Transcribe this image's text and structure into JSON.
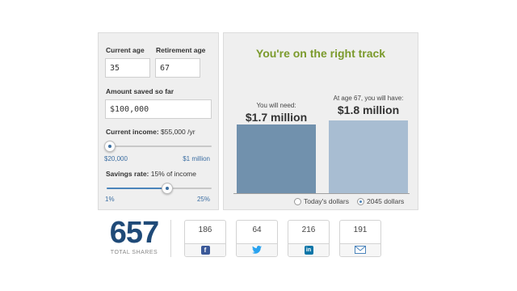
{
  "form": {
    "current_age_label": "Current age",
    "current_age_value": "35",
    "retirement_age_label": "Retirement age",
    "retirement_age_value": "67",
    "amount_saved_label": "Amount saved so far",
    "amount_saved_value": "$100,000",
    "income_label": "Current income:",
    "income_value": "$55,000 /yr",
    "income_min": "$20,000",
    "income_max": "$1 million",
    "income_slider_fraction": 0.03,
    "savings_label": "Savings rate:",
    "savings_value": "15%  of income",
    "savings_min": "1%",
    "savings_max": "25%",
    "savings_slider_fraction": 0.58
  },
  "result": {
    "headline": "You're on the right track",
    "need_caption": "You will need:",
    "need_amount": "$1.7 million",
    "need_value_millions": 1.7,
    "have_caption": "At age 67, you will have:",
    "have_amount": "$1.8 million",
    "have_value_millions": 1.8,
    "option_today": "Today's dollars",
    "option_2045": "2045 dollars",
    "selected_option": "2045 dollars",
    "colors": {
      "need_bar": "#7191ad",
      "have_bar": "#a8bdd2",
      "headline": "#7b9a2c"
    }
  },
  "shares": {
    "total": "657",
    "total_label": "TOTAL SHARES",
    "buttons": [
      {
        "count": "186",
        "icon": "facebook-icon"
      },
      {
        "count": "64",
        "icon": "twitter-icon"
      },
      {
        "count": "216",
        "icon": "linkedin-icon"
      },
      {
        "count": "191",
        "icon": "email-icon"
      }
    ]
  }
}
